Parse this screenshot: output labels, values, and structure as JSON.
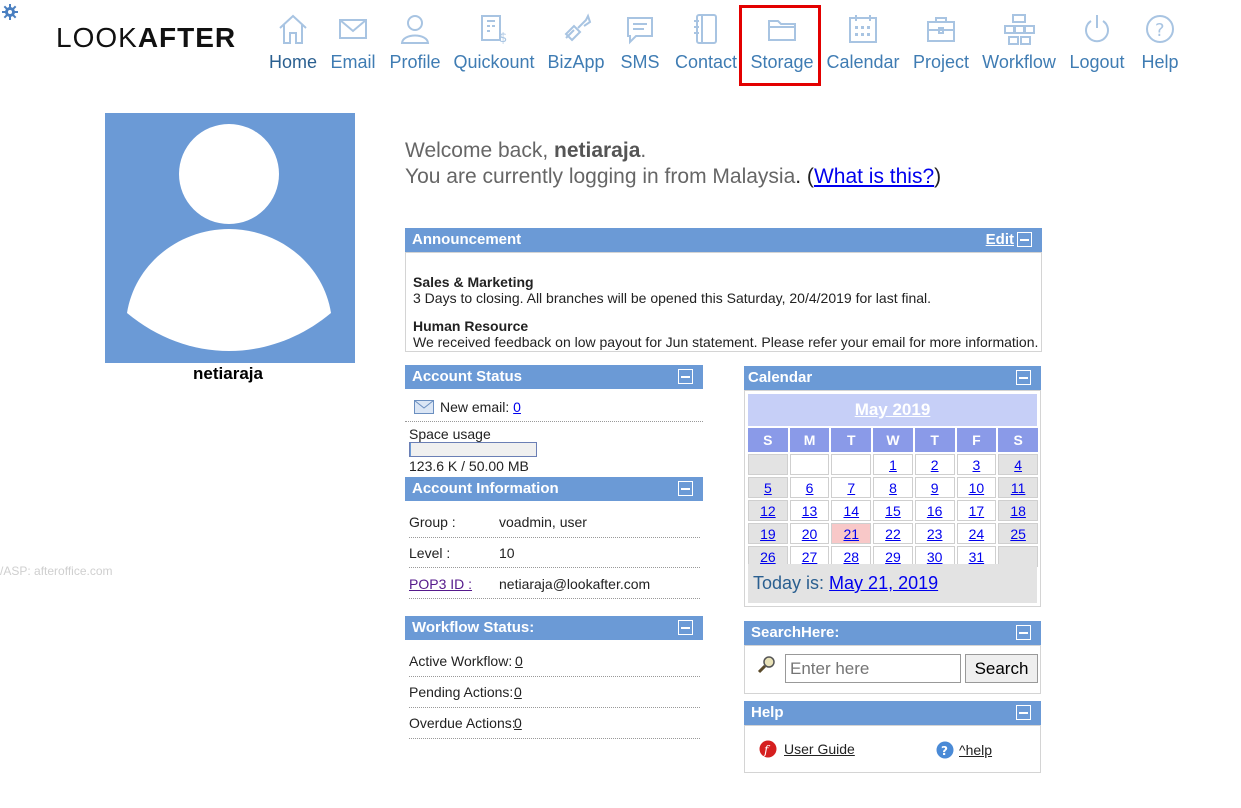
{
  "brand": {
    "logo_light": "LOOK",
    "logo_bold": "AFTER"
  },
  "nav": [
    {
      "label": "Home",
      "icon": "home-icon"
    },
    {
      "label": "Email",
      "icon": "mail-icon"
    },
    {
      "label": "Profile",
      "icon": "user-icon"
    },
    {
      "label": "Quickount",
      "icon": "quickount-icon"
    },
    {
      "label": "BizApp",
      "icon": "bizapp-icon"
    },
    {
      "label": "SMS",
      "icon": "sms-icon"
    },
    {
      "label": "Contact",
      "icon": "contact-book-icon"
    },
    {
      "label": "Storage",
      "icon": "folder-icon"
    },
    {
      "label": "Calendar",
      "icon": "calendar-icon"
    },
    {
      "label": "Project",
      "icon": "briefcase-icon"
    },
    {
      "label": "Workflow",
      "icon": "workflow-icon"
    },
    {
      "label": "Logout",
      "icon": "power-icon"
    },
    {
      "label": "Help",
      "icon": "help-icon"
    }
  ],
  "user": {
    "name": "netiaraja"
  },
  "footer_note": "/ASP: afteroffice.com",
  "welcome": {
    "prefix": "Welcome back, ",
    "name": "netiaraja",
    "suffix": ".",
    "location_text": "You are currently logging in from Malaysia",
    "location_end": ". (",
    "link": "What is this?",
    "close": ")"
  },
  "announcement": {
    "title": "Announcement",
    "edit": "Edit",
    "items": [
      {
        "heading": "Sales & Marketing",
        "text": "3 Days to closing. All branches will be opened this Saturday, 20/4/2019 for last final."
      },
      {
        "heading": "Human Resource",
        "text": "We received feedback on low payout for Jun statement. Please refer your email for more information."
      }
    ]
  },
  "account_status": {
    "title": "Account Status",
    "new_email_label": "New email:",
    "new_email_count": "0",
    "space_label": "Space usage",
    "space_fraction": 0.0024,
    "space_value": "123.6 K / 50.00 MB"
  },
  "account_info": {
    "title": "Account Information",
    "rows": [
      {
        "label": "Group :",
        "value": "voadmin, user"
      },
      {
        "label": "Level :",
        "value": "10"
      },
      {
        "label": "POP3 ID :",
        "value": "netiaraja@lookafter.com"
      }
    ]
  },
  "workflow_status": {
    "title": "Workflow Status:",
    "rows": [
      {
        "label": "Active Workflow:",
        "value": "0"
      },
      {
        "label": "Pending Actions:",
        "value": "0"
      },
      {
        "label": "Overdue Actions:",
        "value": "0"
      }
    ]
  },
  "calendar": {
    "title": "Calendar",
    "month": "May 2019",
    "weekdays": [
      "S",
      "M",
      "T",
      "W",
      "T",
      "F",
      "S"
    ],
    "weeks": [
      [
        "",
        "",
        "",
        "1",
        "2",
        "3",
        "4"
      ],
      [
        "5",
        "6",
        "7",
        "8",
        "9",
        "10",
        "11"
      ],
      [
        "12",
        "13",
        "14",
        "15",
        "16",
        "17",
        "18"
      ],
      [
        "19",
        "20",
        "21",
        "22",
        "23",
        "24",
        "25"
      ],
      [
        "26",
        "27",
        "28",
        "29",
        "30",
        "31",
        ""
      ]
    ],
    "today_day": "21",
    "today_label": "Today is: ",
    "today_date": "May 21, 2019"
  },
  "search": {
    "title": "SearchHere:",
    "placeholder": "Enter here",
    "button": "Search"
  },
  "help": {
    "title": "Help",
    "user_guide": "User Guide",
    "help_link": "^help"
  },
  "colors": {
    "panel_header": "#6b9ad6",
    "nav": "#3f7cb3",
    "highlight": "#e30000",
    "weekday_header": "#8a9ae8"
  }
}
